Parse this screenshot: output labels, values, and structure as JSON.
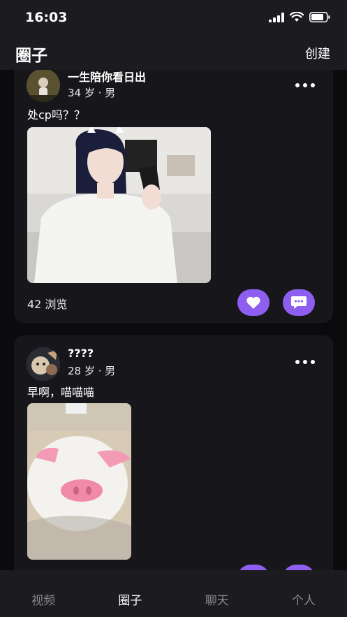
{
  "status_bar": {
    "time": "16:03"
  },
  "header": {
    "title": "圈子",
    "create_label": "创建"
  },
  "posts": [
    {
      "username": "一生陪你看日出",
      "meta": "34 岁 · 男",
      "text": "处cp吗？？",
      "views": "42 浏览"
    },
    {
      "username": "????",
      "meta": "28 岁 · 男",
      "text": "早啊，喵喵喵"
    }
  ],
  "tabs": [
    {
      "label": "视频",
      "active": false
    },
    {
      "label": "圈子",
      "active": true
    },
    {
      "label": "聊天",
      "active": false
    },
    {
      "label": "个人",
      "active": false
    }
  ],
  "colors": {
    "accent": "#8e5ef0",
    "background": "#0b0b0d",
    "card": "#17171b"
  }
}
